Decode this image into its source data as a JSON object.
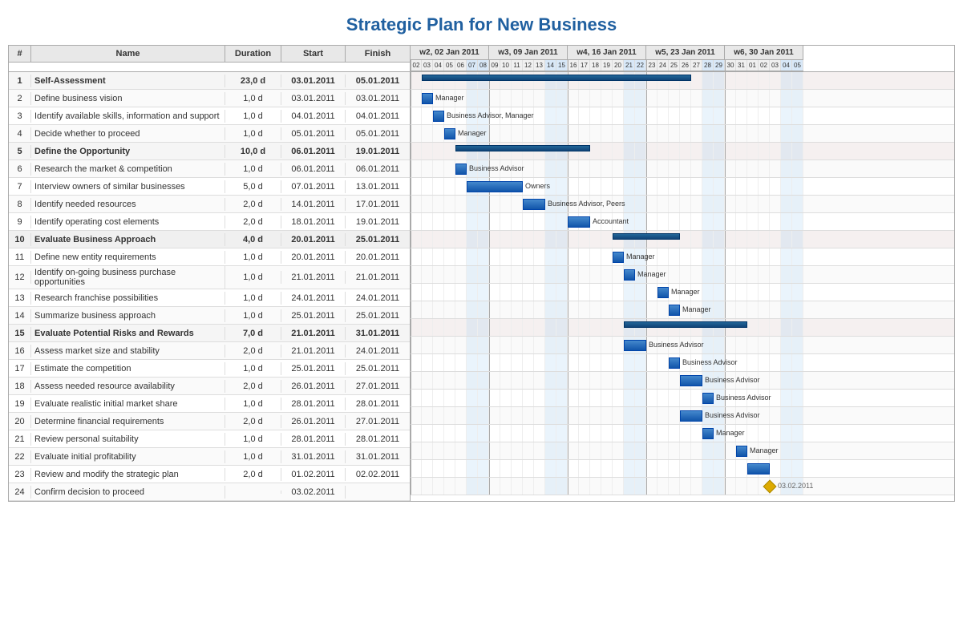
{
  "title": "Strategic Plan for New Business",
  "columns": {
    "num": "#",
    "name": "Name",
    "duration": "Duration",
    "start": "Start",
    "finish": "Finish"
  },
  "weeks": [
    {
      "label": "w2, 02 Jan 2011",
      "days": [
        "02",
        "03",
        "04",
        "05",
        "06",
        "07",
        "08"
      ],
      "startDay": 0
    },
    {
      "label": "w3, 09 Jan 2011",
      "days": [
        "09",
        "10",
        "11",
        "12",
        "13",
        "14",
        "15"
      ],
      "startDay": 7
    },
    {
      "label": "w4, 16 Jan 2011",
      "days": [
        "16",
        "17",
        "18",
        "19",
        "20",
        "21",
        "22"
      ],
      "startDay": 14
    },
    {
      "label": "w5, 23 Jan 2011",
      "days": [
        "23",
        "24",
        "25",
        "26",
        "27",
        "28",
        "29"
      ],
      "startDay": 21
    },
    {
      "label": "w6, 30 Jan 2011",
      "days": [
        "30",
        "31",
        "01",
        "02",
        "03",
        "04",
        "05"
      ],
      "startDay": 28
    }
  ],
  "tasks": [
    {
      "id": 1,
      "name": "Self-Assessment",
      "duration": "23,0 d",
      "start": "03.01.2011",
      "finish": "05.01.2011",
      "isGroup": true,
      "barStart": 1,
      "barLen": 24,
      "label": ""
    },
    {
      "id": 2,
      "name": "Define business vision",
      "duration": "1,0 d",
      "start": "03.01.2011",
      "finish": "03.01.2011",
      "isGroup": false,
      "barStart": 1,
      "barLen": 1,
      "label": "Manager"
    },
    {
      "id": 3,
      "name": "Identify available skills, information and support",
      "duration": "1,0 d",
      "start": "04.01.2011",
      "finish": "04.01.2011",
      "isGroup": false,
      "barStart": 2,
      "barLen": 1,
      "label": "Business Advisor, Manager"
    },
    {
      "id": 4,
      "name": "Decide whether to proceed",
      "duration": "1,0 d",
      "start": "05.01.2011",
      "finish": "05.01.2011",
      "isGroup": false,
      "barStart": 3,
      "barLen": 1,
      "label": "Manager"
    },
    {
      "id": 5,
      "name": "Define the Opportunity",
      "duration": "10,0 d",
      "start": "06.01.2011",
      "finish": "19.01.2011",
      "isGroup": true,
      "barStart": 4,
      "barLen": 12,
      "label": ""
    },
    {
      "id": 6,
      "name": "Research the market & competition",
      "duration": "1,0 d",
      "start": "06.01.2011",
      "finish": "06.01.2011",
      "isGroup": false,
      "barStart": 4,
      "barLen": 1,
      "label": "Business Advisor"
    },
    {
      "id": 7,
      "name": "Interview owners of similar businesses",
      "duration": "5,0 d",
      "start": "07.01.2011",
      "finish": "13.01.2011",
      "isGroup": false,
      "barStart": 5,
      "barLen": 5,
      "label": "Owners"
    },
    {
      "id": 8,
      "name": "Identify needed resources",
      "duration": "2,0 d",
      "start": "14.01.2011",
      "finish": "17.01.2011",
      "isGroup": false,
      "barStart": 10,
      "barLen": 2,
      "label": "Business Advisor, Peers"
    },
    {
      "id": 9,
      "name": "Identify operating cost elements",
      "duration": "2,0 d",
      "start": "18.01.2011",
      "finish": "19.01.2011",
      "isGroup": false,
      "barStart": 14,
      "barLen": 2,
      "label": "Accountant"
    },
    {
      "id": 10,
      "name": "Evaluate Business Approach",
      "duration": "4,0 d",
      "start": "20.01.2011",
      "finish": "25.01.2011",
      "isGroup": true,
      "barStart": 18,
      "barLen": 6,
      "label": ""
    },
    {
      "id": 11,
      "name": "Define new entity requirements",
      "duration": "1,0 d",
      "start": "20.01.2011",
      "finish": "20.01.2011",
      "isGroup": false,
      "barStart": 18,
      "barLen": 1,
      "label": "Manager"
    },
    {
      "id": 12,
      "name": "Identify on-going business purchase opportunities",
      "duration": "1,0 d",
      "start": "21.01.2011",
      "finish": "21.01.2011",
      "isGroup": false,
      "barStart": 19,
      "barLen": 1,
      "label": "Manager"
    },
    {
      "id": 13,
      "name": "Research franchise possibilities",
      "duration": "1,0 d",
      "start": "24.01.2011",
      "finish": "24.01.2011",
      "isGroup": false,
      "barStart": 22,
      "barLen": 1,
      "label": "Manager"
    },
    {
      "id": 14,
      "name": "Summarize business approach",
      "duration": "1,0 d",
      "start": "25.01.2011",
      "finish": "25.01.2011",
      "isGroup": false,
      "barStart": 23,
      "barLen": 1,
      "label": "Manager"
    },
    {
      "id": 15,
      "name": "Evaluate Potential Risks and Rewards",
      "duration": "7,0 d",
      "start": "21.01.2011",
      "finish": "31.01.2011",
      "isGroup": true,
      "barStart": 19,
      "barLen": 11,
      "label": ""
    },
    {
      "id": 16,
      "name": "Assess market size and stability",
      "duration": "2,0 d",
      "start": "21.01.2011",
      "finish": "24.01.2011",
      "isGroup": false,
      "barStart": 19,
      "barLen": 2,
      "label": "Business Advisor"
    },
    {
      "id": 17,
      "name": "Estimate the competition",
      "duration": "1,0 d",
      "start": "25.01.2011",
      "finish": "25.01.2011",
      "isGroup": false,
      "barStart": 23,
      "barLen": 1,
      "label": "Business Advisor"
    },
    {
      "id": 18,
      "name": "Assess needed resource availability",
      "duration": "2,0 d",
      "start": "26.01.2011",
      "finish": "27.01.2011",
      "isGroup": false,
      "barStart": 24,
      "barLen": 2,
      "label": "Business Advisor"
    },
    {
      "id": 19,
      "name": "Evaluate realistic initial market share",
      "duration": "1,0 d",
      "start": "28.01.2011",
      "finish": "28.01.2011",
      "isGroup": false,
      "barStart": 26,
      "barLen": 1,
      "label": "Business Advisor"
    },
    {
      "id": 20,
      "name": "Determine financial requirements",
      "duration": "2,0 d",
      "start": "26.01.2011",
      "finish": "27.01.2011",
      "isGroup": false,
      "barStart": 24,
      "barLen": 2,
      "label": "Business Advisor"
    },
    {
      "id": 21,
      "name": "Review personal suitability",
      "duration": "1,0 d",
      "start": "28.01.2011",
      "finish": "28.01.2011",
      "isGroup": false,
      "barStart": 26,
      "barLen": 1,
      "label": "Manager"
    },
    {
      "id": 22,
      "name": "Evaluate initial profitability",
      "duration": "1,0 d",
      "start": "31.01.2011",
      "finish": "31.01.2011",
      "isGroup": false,
      "barStart": 29,
      "barLen": 1,
      "label": "Manager"
    },
    {
      "id": 23,
      "name": "Review and modify the strategic plan",
      "duration": "2,0 d",
      "start": "01.02.2011",
      "finish": "02.02.2011",
      "isGroup": false,
      "barStart": 30,
      "barLen": 2,
      "label": ""
    },
    {
      "id": 24,
      "name": "Confirm decision to proceed",
      "duration": "",
      "start": "03.02.2011",
      "finish": "",
      "isGroup": false,
      "barStart": 32,
      "barLen": 0,
      "label": "03.02.2011",
      "isDiamond": true
    }
  ]
}
